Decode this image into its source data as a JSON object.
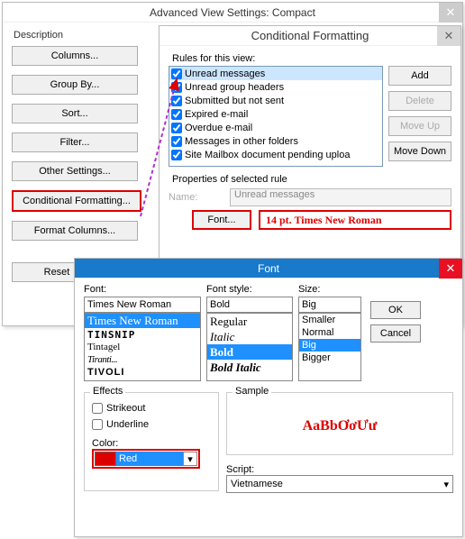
{
  "avs": {
    "title": "Advanced View Settings: Compact",
    "description_label": "Description",
    "buttons": {
      "columns": "Columns...",
      "groupby": "Group By...",
      "sort": "Sort...",
      "filter": "Filter...",
      "other": "Other Settings...",
      "condfmt": "Conditional Formatting...",
      "formatcols": "Format Columns...",
      "reset": "Reset"
    },
    "close": "✕"
  },
  "cf": {
    "title": "Conditional Formatting",
    "close": "✕",
    "rules_label": "Rules for this view:",
    "rules": [
      {
        "label": "Unread messages",
        "checked": true,
        "selected": true
      },
      {
        "label": "Unread group headers",
        "checked": true
      },
      {
        "label": "Submitted but not sent",
        "checked": true
      },
      {
        "label": "Expired e-mail",
        "checked": true
      },
      {
        "label": "Overdue e-mail",
        "checked": true
      },
      {
        "label": "Messages in other folders",
        "checked": true
      },
      {
        "label": "Site Mailbox document pending uploa",
        "checked": true
      }
    ],
    "buttons": {
      "add": "Add",
      "delete": "Delete",
      "moveup": "Move Up",
      "movedown": "Move Down"
    },
    "props_label": "Properties of selected rule",
    "name_label": "Name:",
    "name_value": "Unread messages",
    "font_btn": "Font...",
    "font_preview": "14 pt. Times New Roman"
  },
  "font": {
    "title": "Font",
    "close": "✕",
    "font_label": "Font:",
    "font_value": "Times New Roman",
    "font_list": [
      "Times New Roman",
      "TINSNIP",
      "Tintagel",
      "Tiranti...",
      "TIVOLI"
    ],
    "style_label": "Font style:",
    "style_value": "Bold",
    "style_list": [
      "Regular",
      "Italic",
      "Bold",
      "Bold Italic"
    ],
    "size_label": "Size:",
    "size_value": "Big",
    "size_list": [
      "Smaller",
      "Normal",
      "Big",
      "Bigger"
    ],
    "ok": "OK",
    "cancel": "Cancel",
    "effects_label": "Effects",
    "strikeout": "Strikeout",
    "underline": "Underline",
    "color_label": "Color:",
    "color_value": "Red",
    "color_hex": "#d00000",
    "sample_label": "Sample",
    "sample_text": "AaBbƠơƯư",
    "script_label": "Script:",
    "script_value": "Vietnamese",
    "chevron": "▾"
  }
}
